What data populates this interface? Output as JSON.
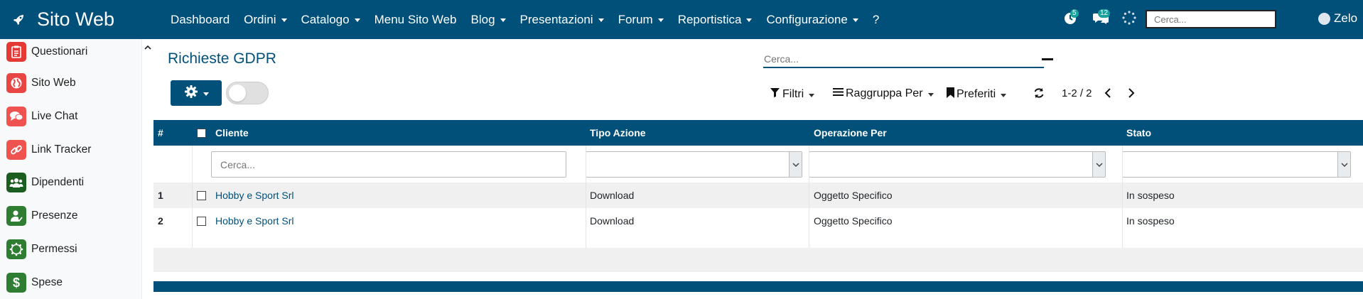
{
  "app": {
    "title": "Sito Web"
  },
  "colors": {
    "nav": "#00507a",
    "accent": "#00507a",
    "badge": "#17a2a0"
  },
  "nav": {
    "items": [
      {
        "label": "Dashboard",
        "dropdown": false
      },
      {
        "label": "Ordini",
        "dropdown": true
      },
      {
        "label": "Catalogo",
        "dropdown": true
      },
      {
        "label": "Menu Sito Web",
        "dropdown": false
      },
      {
        "label": "Blog",
        "dropdown": true
      },
      {
        "label": "Presentazioni",
        "dropdown": true
      },
      {
        "label": "Forum",
        "dropdown": true
      },
      {
        "label": "Reportistica",
        "dropdown": true
      },
      {
        "label": "Configurazione",
        "dropdown": true
      },
      {
        "label": "?",
        "dropdown": false
      }
    ],
    "activity_badge": "5",
    "messages_badge": "12",
    "search_placeholder": "Cerca...",
    "user_name": "Zelo"
  },
  "sidebar": {
    "items": [
      {
        "label": "Questionari",
        "icon": "clipboard-icon",
        "color": "#e53935"
      },
      {
        "label": "Sito Web",
        "icon": "globe-icon",
        "color": "#e84545"
      },
      {
        "label": "Live Chat",
        "icon": "chat-icon",
        "color": "#ef5350"
      },
      {
        "label": "Link Tracker",
        "icon": "link-icon",
        "color": "#ef5350"
      },
      {
        "label": "Dipendenti",
        "icon": "users-icon",
        "color": "#1b5e20"
      },
      {
        "label": "Presenze",
        "icon": "user-check-icon",
        "color": "#2e7d32"
      },
      {
        "label": "Permessi",
        "icon": "sun-icon",
        "color": "#2e7d32"
      },
      {
        "label": "Spese",
        "icon": "dollar-icon",
        "color": "#2e7d32"
      }
    ]
  },
  "page": {
    "title": "Richieste GDPR",
    "search_placeholder": "Cerca...",
    "filters_label": "Filtri",
    "group_label": "Raggruppa Per",
    "favorites_label": "Preferiti",
    "pager": "1-2 / 2"
  },
  "table": {
    "columns": [
      "#",
      "Cliente",
      "Tipo Azione",
      "Operazione Per",
      "Stato"
    ],
    "filter_placeholder": "Cerca...",
    "rows": [
      {
        "num": "1",
        "cliente": "Hobby e Sport Srl",
        "tipo": "Download",
        "operazione": "Oggetto Specifico",
        "stato": "In sospeso"
      },
      {
        "num": "2",
        "cliente": "Hobby e Sport Srl",
        "tipo": "Download",
        "operazione": "Oggetto Specifico",
        "stato": "In sospeso"
      }
    ]
  }
}
